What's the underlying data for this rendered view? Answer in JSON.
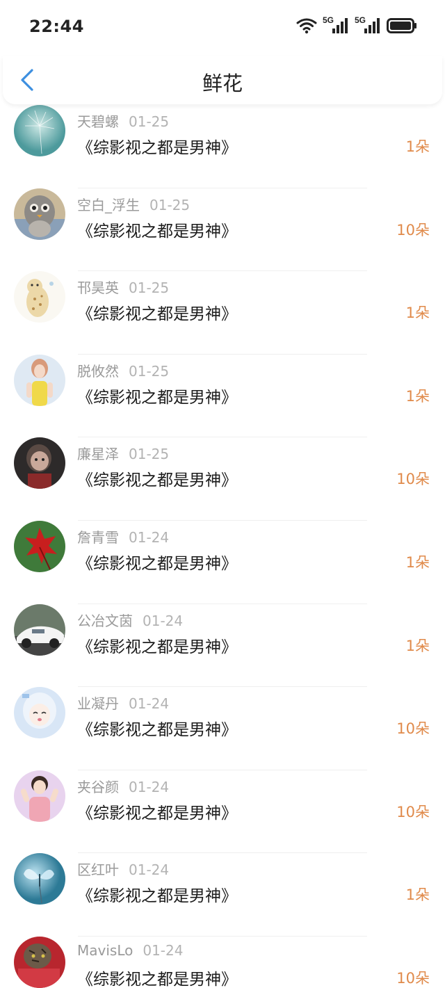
{
  "status_bar": {
    "time": "22:44",
    "network_1": "5G",
    "network_2": "5G"
  },
  "header": {
    "title": "鲜花"
  },
  "colors": {
    "accent_back": "#3d8fe0",
    "count_orange": "#e08a4a"
  },
  "list": [
    {
      "name": "天碧螺",
      "date": "01-25",
      "book": "《综影视之都是男神》",
      "count": "1朵",
      "avatar": "dandelion-teal"
    },
    {
      "name": "空白_浮生",
      "date": "01-25",
      "book": "《综影视之都是男神》",
      "count": "10朵",
      "avatar": "plush-toy"
    },
    {
      "name": "邗昊英",
      "date": "01-25",
      "book": "《综影视之都是男神》",
      "count": "1朵",
      "avatar": "cartoon-cat"
    },
    {
      "name": "脱攸然",
      "date": "01-25",
      "book": "《综影视之都是男神》",
      "count": "1朵",
      "avatar": "girl-yellow"
    },
    {
      "name": "廉星泽",
      "date": "01-25",
      "book": "《综影视之都是男神》",
      "count": "10朵",
      "avatar": "kid-dark"
    },
    {
      "name": "詹青雪",
      "date": "01-24",
      "book": "《综影视之都是男神》",
      "count": "1朵",
      "avatar": "red-leaf"
    },
    {
      "name": "公冶文茵",
      "date": "01-24",
      "book": "《综影视之都是男神》",
      "count": "1朵",
      "avatar": "white-car"
    },
    {
      "name": "业凝丹",
      "date": "01-24",
      "book": "《综影视之都是男神》",
      "count": "10朵",
      "avatar": "anime-girl"
    },
    {
      "name": "夹谷颜",
      "date": "01-24",
      "book": "《综影视之都是男神》",
      "count": "10朵",
      "avatar": "cartoon-girl"
    },
    {
      "name": "区红叶",
      "date": "01-24",
      "book": "《综影视之都是男神》",
      "count": "1朵",
      "avatar": "butterfly-blue"
    },
    {
      "name": "MavisLo",
      "date": "01-24",
      "book": "《综影视之都是男神》",
      "count": "10朵",
      "avatar": "cat-red"
    }
  ]
}
